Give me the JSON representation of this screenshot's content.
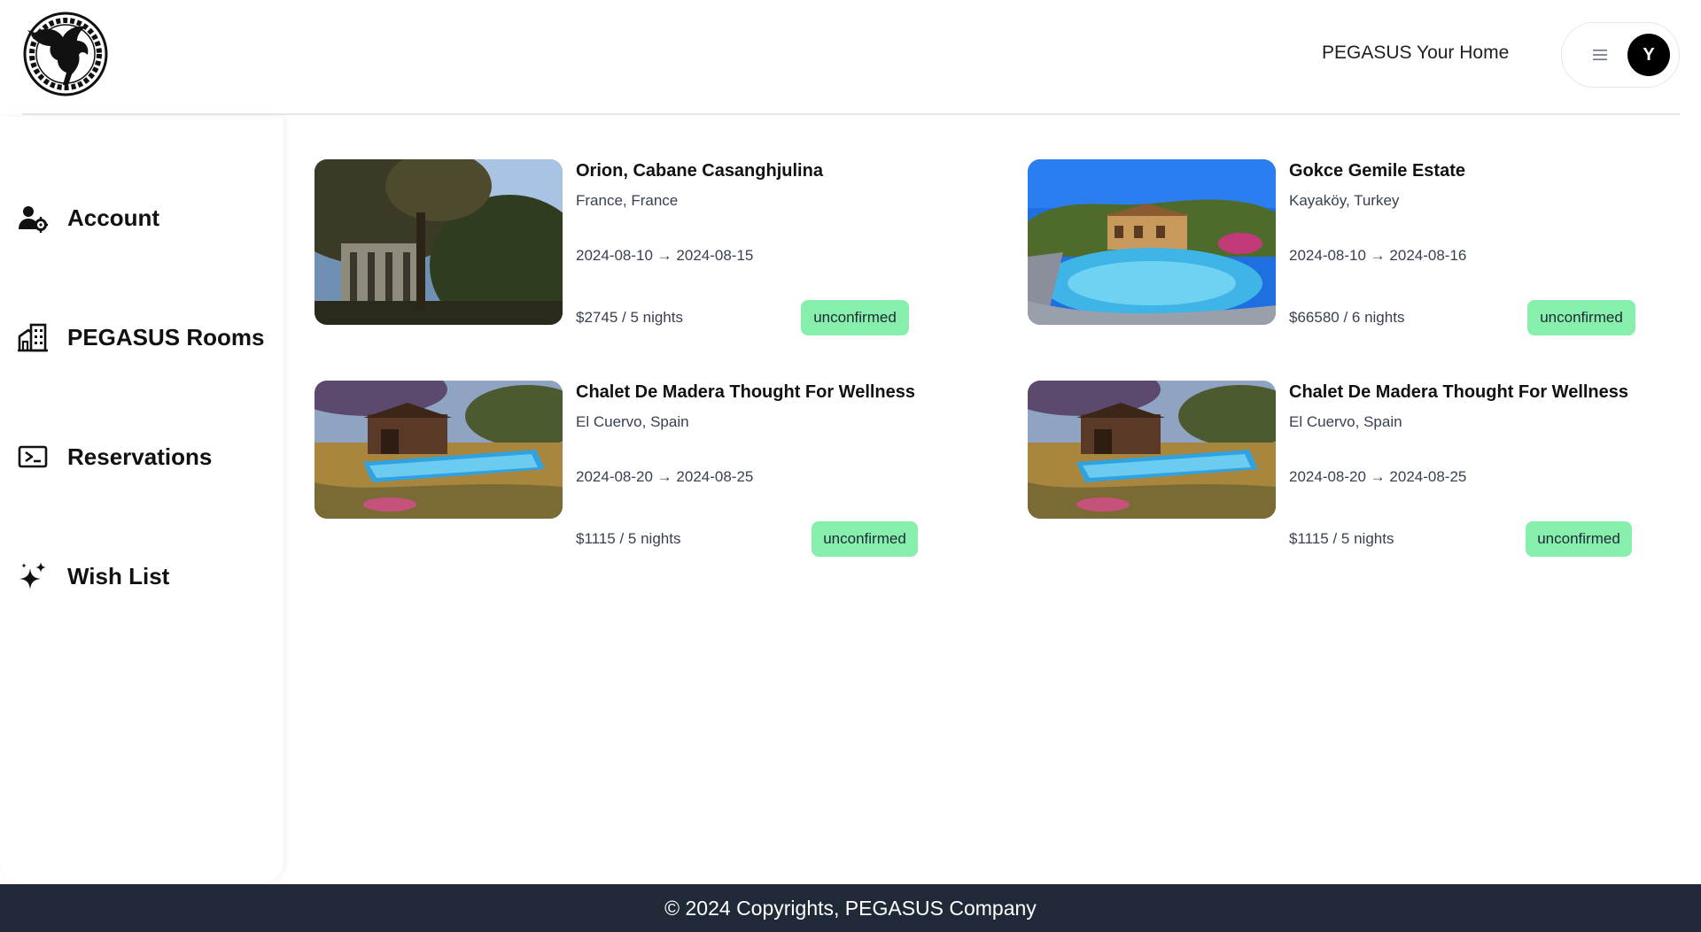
{
  "header": {
    "home_link": "PEGASUS Your Home",
    "avatar_initial": "Y"
  },
  "sidebar": {
    "items": [
      {
        "label": "Account",
        "icon": "user-gear-icon"
      },
      {
        "label": "PEGASUS Rooms",
        "icon": "buildings-icon"
      },
      {
        "label": "Reservations",
        "icon": "ticket-icon"
      },
      {
        "label": "Wish List",
        "icon": "sparkles-icon"
      }
    ]
  },
  "reservations": [
    {
      "title": "Orion, Cabane Casanghjulina",
      "location": "France, France",
      "dates": "2024-08-10 → 2024-08-15",
      "price": "$2745 / 5 nights",
      "status": "unconfirmed"
    },
    {
      "title": "Gokce Gemile Estate",
      "location": "Kayaköy, Turkey",
      "dates": "2024-08-10 → 2024-08-16",
      "price": "$66580 / 6 nights",
      "status": "unconfirmed"
    },
    {
      "title": "Chalet De Madera Thought For Wellness",
      "location": "El Cuervo, Spain",
      "dates": "2024-08-20 → 2024-08-25",
      "price": "$1115 / 5 nights",
      "status": "unconfirmed"
    },
    {
      "title": "Chalet De Madera Thought For Wellness",
      "location": "El Cuervo, Spain",
      "dates": "2024-08-20 → 2024-08-25",
      "price": "$1115 / 5 nights",
      "status": "unconfirmed"
    }
  ],
  "footer": {
    "text": "© 2024 Copyrights, PEGASUS Company"
  },
  "colors": {
    "status_badge": "#86efac",
    "footer_bg": "#1f2937"
  }
}
